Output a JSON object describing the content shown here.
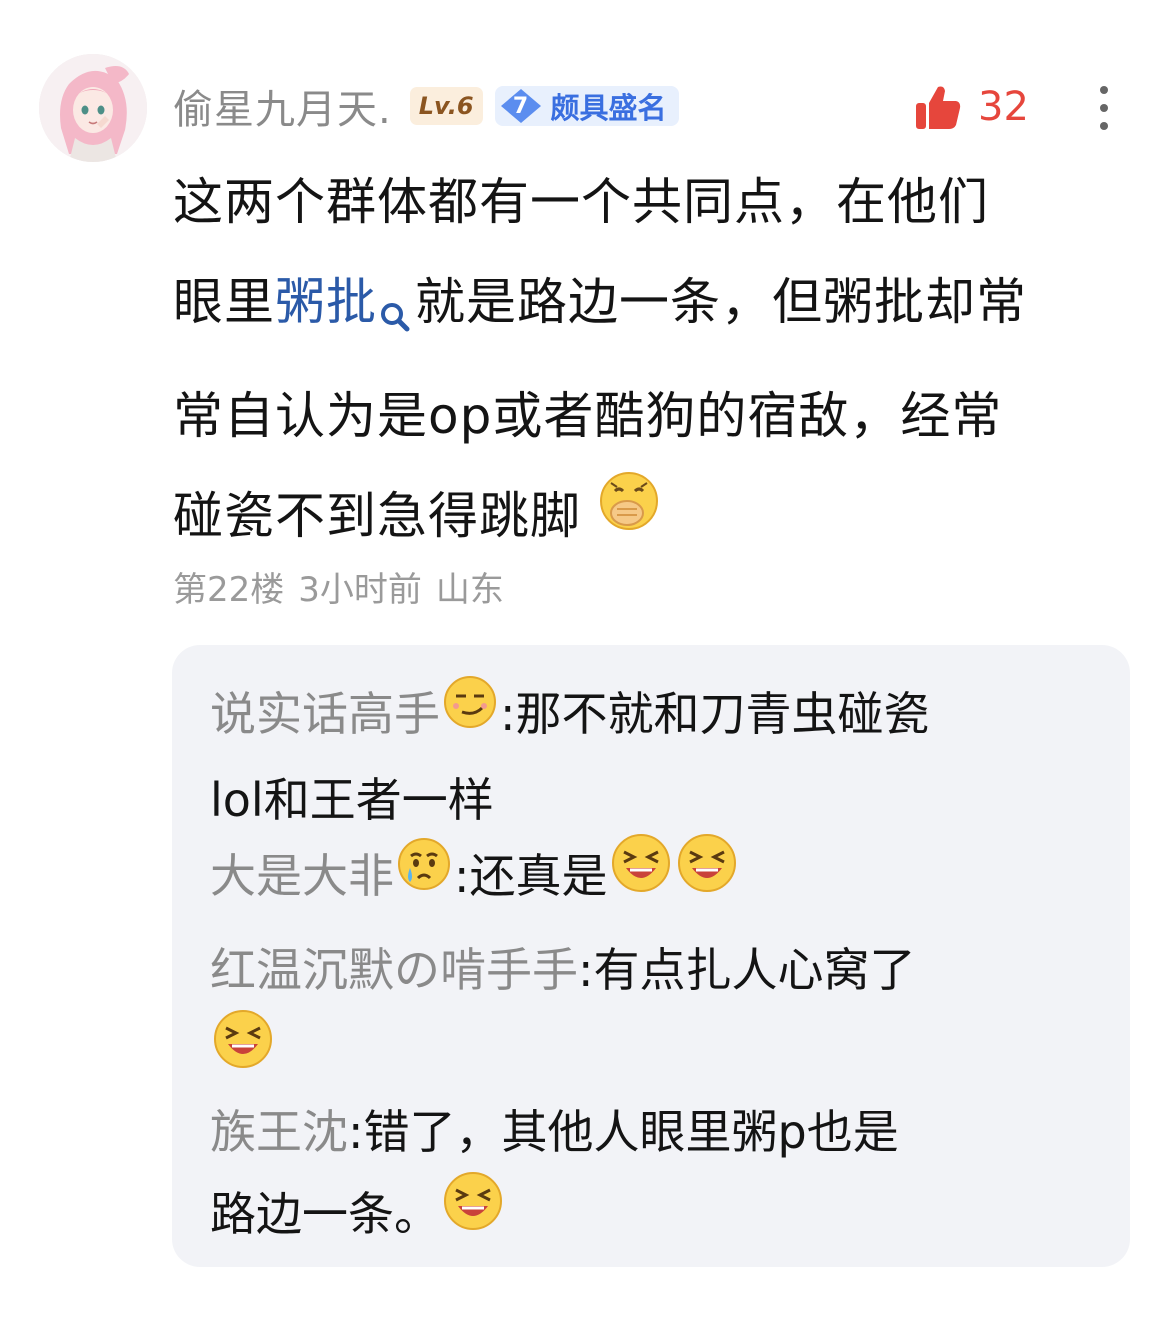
{
  "post": {
    "author": {
      "name": "偷星九月天.",
      "level": "Lv.6",
      "fame_level": "7",
      "fame_title": "颇具盛名",
      "avatar_icon": "anime-girl-avatar"
    },
    "likes": "32",
    "content": {
      "line1": "这两个群体都有一个共同点，在他们",
      "line2_pre": "眼里",
      "line2_link": "粥批",
      "line2_post": "就是路边一条，但粥批却常",
      "line3": "常自认为是op或者酷狗的宿敌，经常",
      "line4": "碰瓷不到急得跳脚",
      "trailing_emoji": "cover-mouth-laugh-emoji"
    },
    "meta": {
      "floor": "第22楼",
      "time": "3小时前",
      "location": "山东"
    }
  },
  "replies": [
    {
      "author": "说实话高手",
      "author_emoji": "smirk-emoji",
      "text1": ":那不就和刀青虫碰瓷",
      "text2": "lol和王者一样"
    },
    {
      "author": "大是大非",
      "author_emoji": "crying-emoji",
      "text1": ":还真是",
      "trailing_emojis": [
        "laughing-emoji",
        "laughing-emoji"
      ]
    },
    {
      "author": "红温沉默の啃手手",
      "text1": ":有点扎人心窝了",
      "trailing_emojis": [
        "laughing-emoji"
      ]
    },
    {
      "author": "族王沈",
      "text1": ":错了，其他人眼里粥p也是",
      "text2": "路边一条。",
      "trailing_emojis": [
        "laughing-emoji"
      ]
    }
  ],
  "colors": {
    "accent_red": "#e6463c",
    "link_blue": "#2b5aa8",
    "muted_gray": "#8a8a8a",
    "reply_bg": "#f2f3f7",
    "level_badge_bg": "#fbeedd",
    "fame_badge_bg": "#e8f0fd"
  }
}
